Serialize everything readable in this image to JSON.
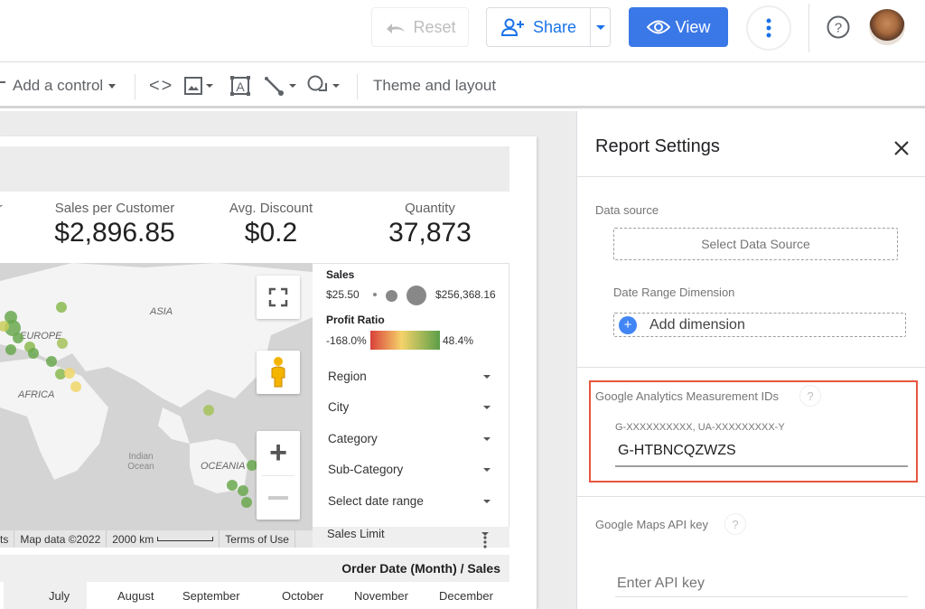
{
  "topbar": {
    "reset_label": "Reset",
    "share_label": "Share",
    "view_label": "View",
    "icons": [
      "undo-icon",
      "person-add-icon",
      "chevron-down-icon",
      "eye-icon",
      "more-vert-icon",
      "help-icon",
      "avatar"
    ],
    "accent": "#3b78e7"
  },
  "toolbar": {
    "add_control_label": "Add a control",
    "theme_layout_label": "Theme and layout",
    "icons": [
      "embed-code-icon",
      "image-icon",
      "text-box-icon",
      "line-icon",
      "shape-icon"
    ]
  },
  "kpis": [
    {
      "label": "Sales per Customer",
      "value": "$2,896.85"
    },
    {
      "label": "Avg. Discount",
      "value": "$0.2"
    },
    {
      "label": "Quantity",
      "value": "37,873"
    }
  ],
  "kpi_partial_label": "r",
  "map": {
    "labels": {
      "asia": "ASIA",
      "europe": "EUROPE",
      "africa": "AFRICA",
      "oceania": "OCEANIA",
      "ocean": "Indian Ocean"
    },
    "footer": {
      "shortcuts": "ts",
      "mapdata": "Map data ©2022",
      "scale": "2000 km",
      "terms": "Terms of Use"
    }
  },
  "legend": {
    "sales_title": "Sales",
    "sales_min": "$25.50",
    "sales_max": "$256,368.16",
    "profit_title": "Profit Ratio",
    "profit_min": "-168.0%",
    "profit_max": "48.4%",
    "colors": {
      "low": "#d9403a",
      "mid": "#f5d36a",
      "high": "#5a9e48"
    }
  },
  "controls": [
    "Region",
    "City",
    "Category",
    "Sub-Category",
    "Select date range"
  ],
  "sales_limit_label": "Sales Limit",
  "table": {
    "title": "Order Date (Month) / Sales",
    "months": [
      "July",
      "August",
      "September",
      "October",
      "November",
      "December"
    ]
  },
  "panel": {
    "title": "Report Settings",
    "data_source_label": "Data source",
    "select_data_source": "Select Data Source",
    "date_range_label": "Date Range Dimension",
    "add_dimension": "Add dimension",
    "ga_label": "Google Analytics Measurement IDs",
    "ga_hint": "G-XXXXXXXXXX, UA-XXXXXXXXX-Y",
    "ga_value": "G-HTBNCQZWZS",
    "maps_label": "Google Maps API key",
    "maps_placeholder": "Enter API key",
    "help_glyph": "?",
    "highlight_color": "#e8553e"
  }
}
